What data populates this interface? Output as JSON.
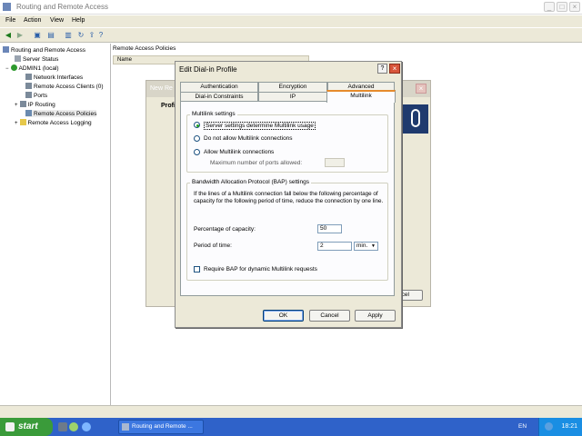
{
  "window": {
    "title": "Routing and Remote Access",
    "buttons": {
      "minimize": "_",
      "maximize": "□",
      "close": "×"
    }
  },
  "menu": [
    "File",
    "Action",
    "View",
    "Help"
  ],
  "toolbar_icons": [
    "back-icon",
    "forward-icon",
    "up-icon",
    "console-tree-icon",
    "properties-icon",
    "refresh-icon",
    "export-icon",
    "help-icon"
  ],
  "tree": {
    "items": [
      {
        "label": "Routing and Remote Access"
      },
      {
        "label": "Server Status"
      },
      {
        "label": "ADMIN1 (local)"
      },
      {
        "label": "Network Interfaces"
      },
      {
        "label": "Remote Access Clients (0)"
      },
      {
        "label": "Ports"
      },
      {
        "label": "IP Routing"
      },
      {
        "label": "Remote Access Policies"
      },
      {
        "label": "Remote Access Logging"
      }
    ]
  },
  "right_pane": {
    "header": "Remote Access Policies",
    "column": "Name"
  },
  "bg_dialog": {
    "title_fragment": "New Re",
    "body_fragment": "Profi",
    "cancel_fragment": "ncel"
  },
  "dialog": {
    "title": "Edit Dial-in Profile",
    "help_button": "?",
    "close_button": "×",
    "tabs_row1": [
      "Authentication",
      "Encryption",
      "Advanced"
    ],
    "tabs_row2": [
      "Dial-in Constraints",
      "IP",
      "Multilink"
    ],
    "multilink": {
      "group_label": "Multilink settings",
      "options": [
        "Server settings determine Multilink usage",
        "Do not allow Multilink connections",
        "Allow Multilink connections"
      ],
      "selected_option": "Server settings determine Multilink usage",
      "max_ports_label": "Maximum number of ports allowed:",
      "max_ports_value": ""
    },
    "bap": {
      "group_label": "Bandwidth Allocation Protocol (BAP) settings",
      "description": "If the lines of a Multilink connection fall below the following percentage of capacity for the following period of time, reduce the connection by one line.",
      "capacity_label": "Percentage of capacity:",
      "capacity_value": "50",
      "period_label": "Period of time:",
      "period_value": "2",
      "period_unit": "min.",
      "require_bap_label": "Require BAP for dynamic Multilink requests",
      "require_bap_checked": false
    },
    "buttons": {
      "ok": "OK",
      "cancel": "Cancel",
      "apply": "Apply"
    }
  },
  "taskbar": {
    "start": "start",
    "task": "Routing and Remote ...",
    "language": "EN",
    "clock": "18:21"
  }
}
